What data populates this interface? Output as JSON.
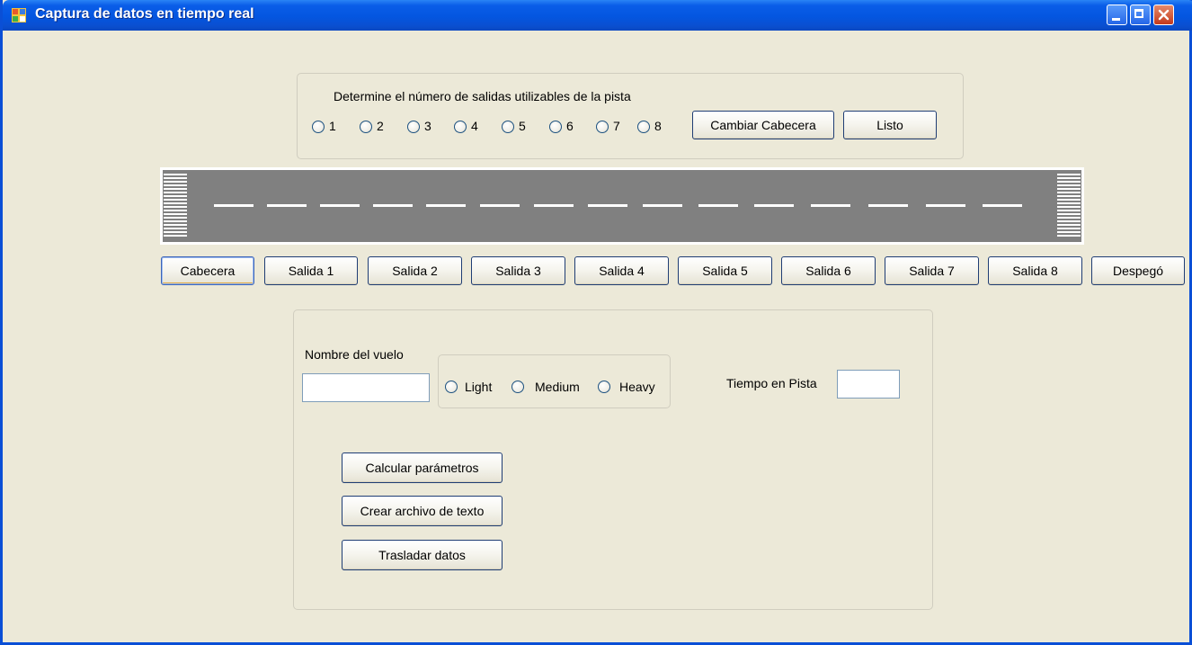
{
  "window": {
    "title": "Captura de datos en tiempo real"
  },
  "exits": {
    "prompt": "Determine el número de salidas utilizables de la pista",
    "options": [
      "1",
      "2",
      "3",
      "4",
      "5",
      "6",
      "7",
      "8"
    ],
    "change_header_label": "Cambiar Cabecera",
    "ready_label": "Listo"
  },
  "runway_buttons": [
    "Cabecera",
    "Salida 1",
    "Salida 2",
    "Salida 3",
    "Salida 4",
    "Salida 5",
    "Salida 6",
    "Salida 7",
    "Salida 8",
    "Despegó"
  ],
  "flight": {
    "name_label": "Nombre del vuelo",
    "name_value": "",
    "categories": [
      "Light",
      "Medium",
      "Heavy"
    ],
    "runway_time_label": "Tiempo en Pista",
    "runway_time_value": ""
  },
  "actions": {
    "calculate_label": "Calcular parámetros",
    "create_file_label": "Crear archivo de texto",
    "transfer_label": "Trasladar datos"
  },
  "colors": {
    "titlebar": "#0456e0",
    "runway": "#808080",
    "background": "#ece9d8"
  }
}
